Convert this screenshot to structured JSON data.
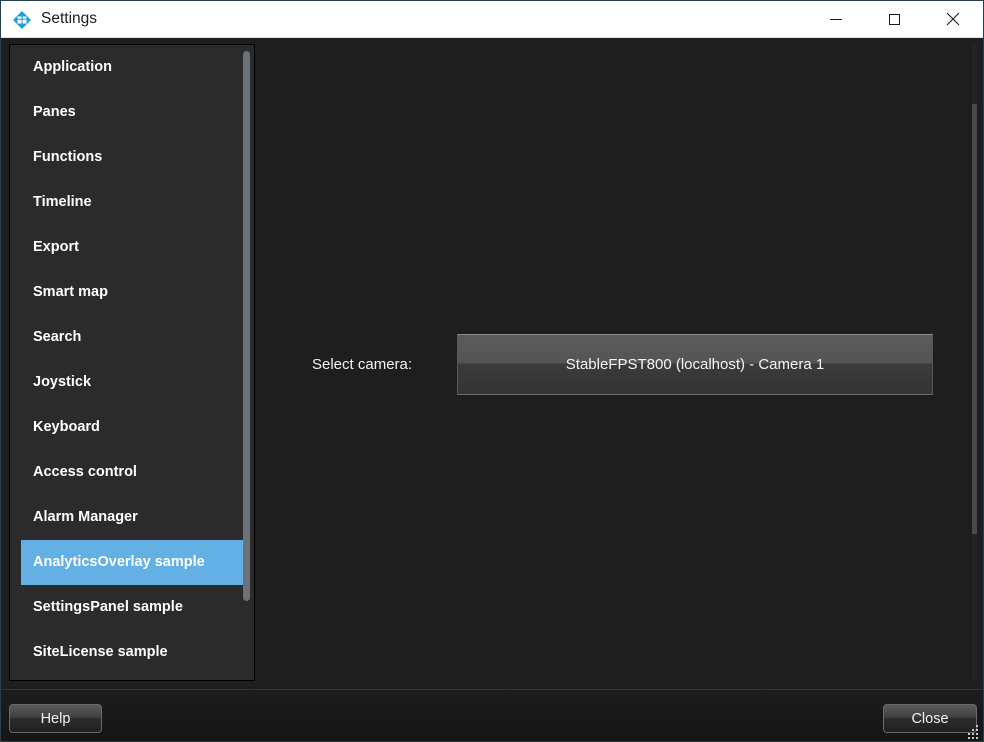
{
  "window": {
    "title": "Settings",
    "app_icon": "milestone-diamond-icon",
    "controls": {
      "minimize": "minimize-icon",
      "maximize": "maximize-icon",
      "close": "close-icon"
    }
  },
  "sidebar": {
    "selected_index": 11,
    "items": [
      {
        "label": "Application"
      },
      {
        "label": "Panes"
      },
      {
        "label": "Functions"
      },
      {
        "label": "Timeline"
      },
      {
        "label": "Export"
      },
      {
        "label": "Smart map"
      },
      {
        "label": "Search"
      },
      {
        "label": "Joystick"
      },
      {
        "label": "Keyboard"
      },
      {
        "label": "Access control"
      },
      {
        "label": "Alarm Manager"
      },
      {
        "label": "AnalyticsOverlay sample"
      },
      {
        "label": "SettingsPanel sample"
      },
      {
        "label": "SiteLicense sample"
      }
    ]
  },
  "content": {
    "select_camera_label": "Select camera:",
    "selected_camera": "StableFPST800 (localhost) - Camera 1"
  },
  "footer": {
    "help_label": "Help",
    "close_label": "Close"
  },
  "colors": {
    "selection_blue": "#63b0e4",
    "titlebar_bg": "#ffffff",
    "window_bg": "#1e1e1e",
    "sidebar_bg": "#2b2b2b",
    "accent_border": "#24404c"
  }
}
